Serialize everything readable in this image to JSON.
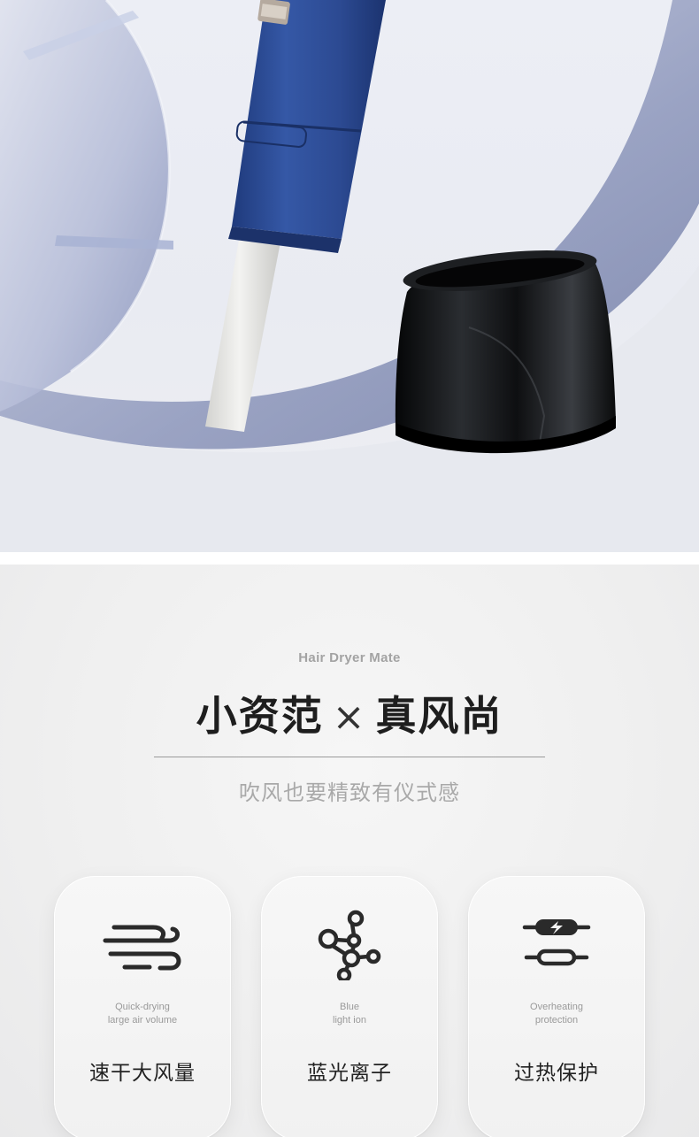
{
  "hero": {
    "colors": {
      "blue": "#2f4d94",
      "disc": "#9aa4c6",
      "cap": "#101214",
      "nozzle": "#e6e6e3"
    }
  },
  "intro": {
    "eyebrow": "Hair Dryer Mate",
    "headline_left": "小资范",
    "headline_sep": "×",
    "headline_right": "真风尚",
    "subline": "吹风也要精致有仪式感"
  },
  "features": [
    {
      "icon": "wind-icon",
      "en_line1": "Quick-drying",
      "en_line2": "large air volume",
      "cn": "速干大风量"
    },
    {
      "icon": "molecule-icon",
      "en_line1": "Blue",
      "en_line2": "light ion",
      "cn": "蓝光离子"
    },
    {
      "icon": "overheat-protection-icon",
      "en_line1": "Overheating",
      "en_line2": "protection",
      "cn": "过热保护"
    }
  ]
}
